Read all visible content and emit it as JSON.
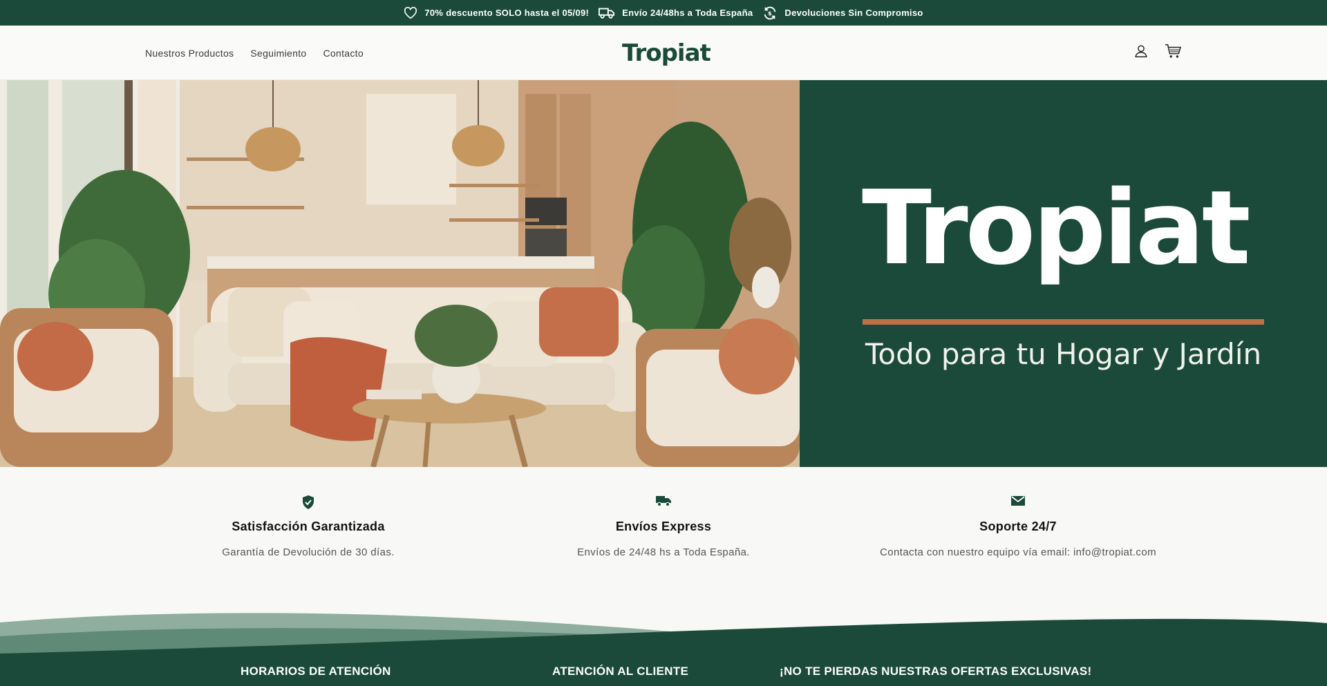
{
  "announcement": {
    "items": [
      {
        "icon": "heart-icon",
        "text": "70% descuento SOLO hasta el 05/09!"
      },
      {
        "icon": "truck-icon",
        "text": "Envío 24/48hs a Toda España"
      },
      {
        "icon": "refresh-icon",
        "text": "Devoluciones Sin Compromiso"
      }
    ]
  },
  "header": {
    "nav": [
      "Nuestros Productos",
      "Seguimiento",
      "Contacto"
    ],
    "logo": "Tropiat",
    "icons": [
      "account-icon",
      "cart-icon"
    ]
  },
  "hero": {
    "brand": "Tropiat",
    "tagline": "Todo para tu Hogar y Jardín",
    "accent_color": "#c26f45",
    "panel_color": "#1b4a3a"
  },
  "features": [
    {
      "icon": "shield-check-icon",
      "title": "Satisfacción Garantizada",
      "text": "Garantía de Devolución de 30 días."
    },
    {
      "icon": "truck-icon",
      "title": "Envíos Express",
      "text": "Envíos de 24/48 hs a Toda España."
    },
    {
      "icon": "mail-icon",
      "title": "Soporte 24/7",
      "text": "Contacta con nuestro equipo vía email: info@tropiat.com"
    }
  ],
  "footer": {
    "headings": [
      "HORARIOS DE ATENCIÓN",
      "ATENCIÓN AL CLIENTE",
      "¡NO TE PIERDAS NUESTRAS OFERTAS EXCLUSIVAS!"
    ]
  }
}
